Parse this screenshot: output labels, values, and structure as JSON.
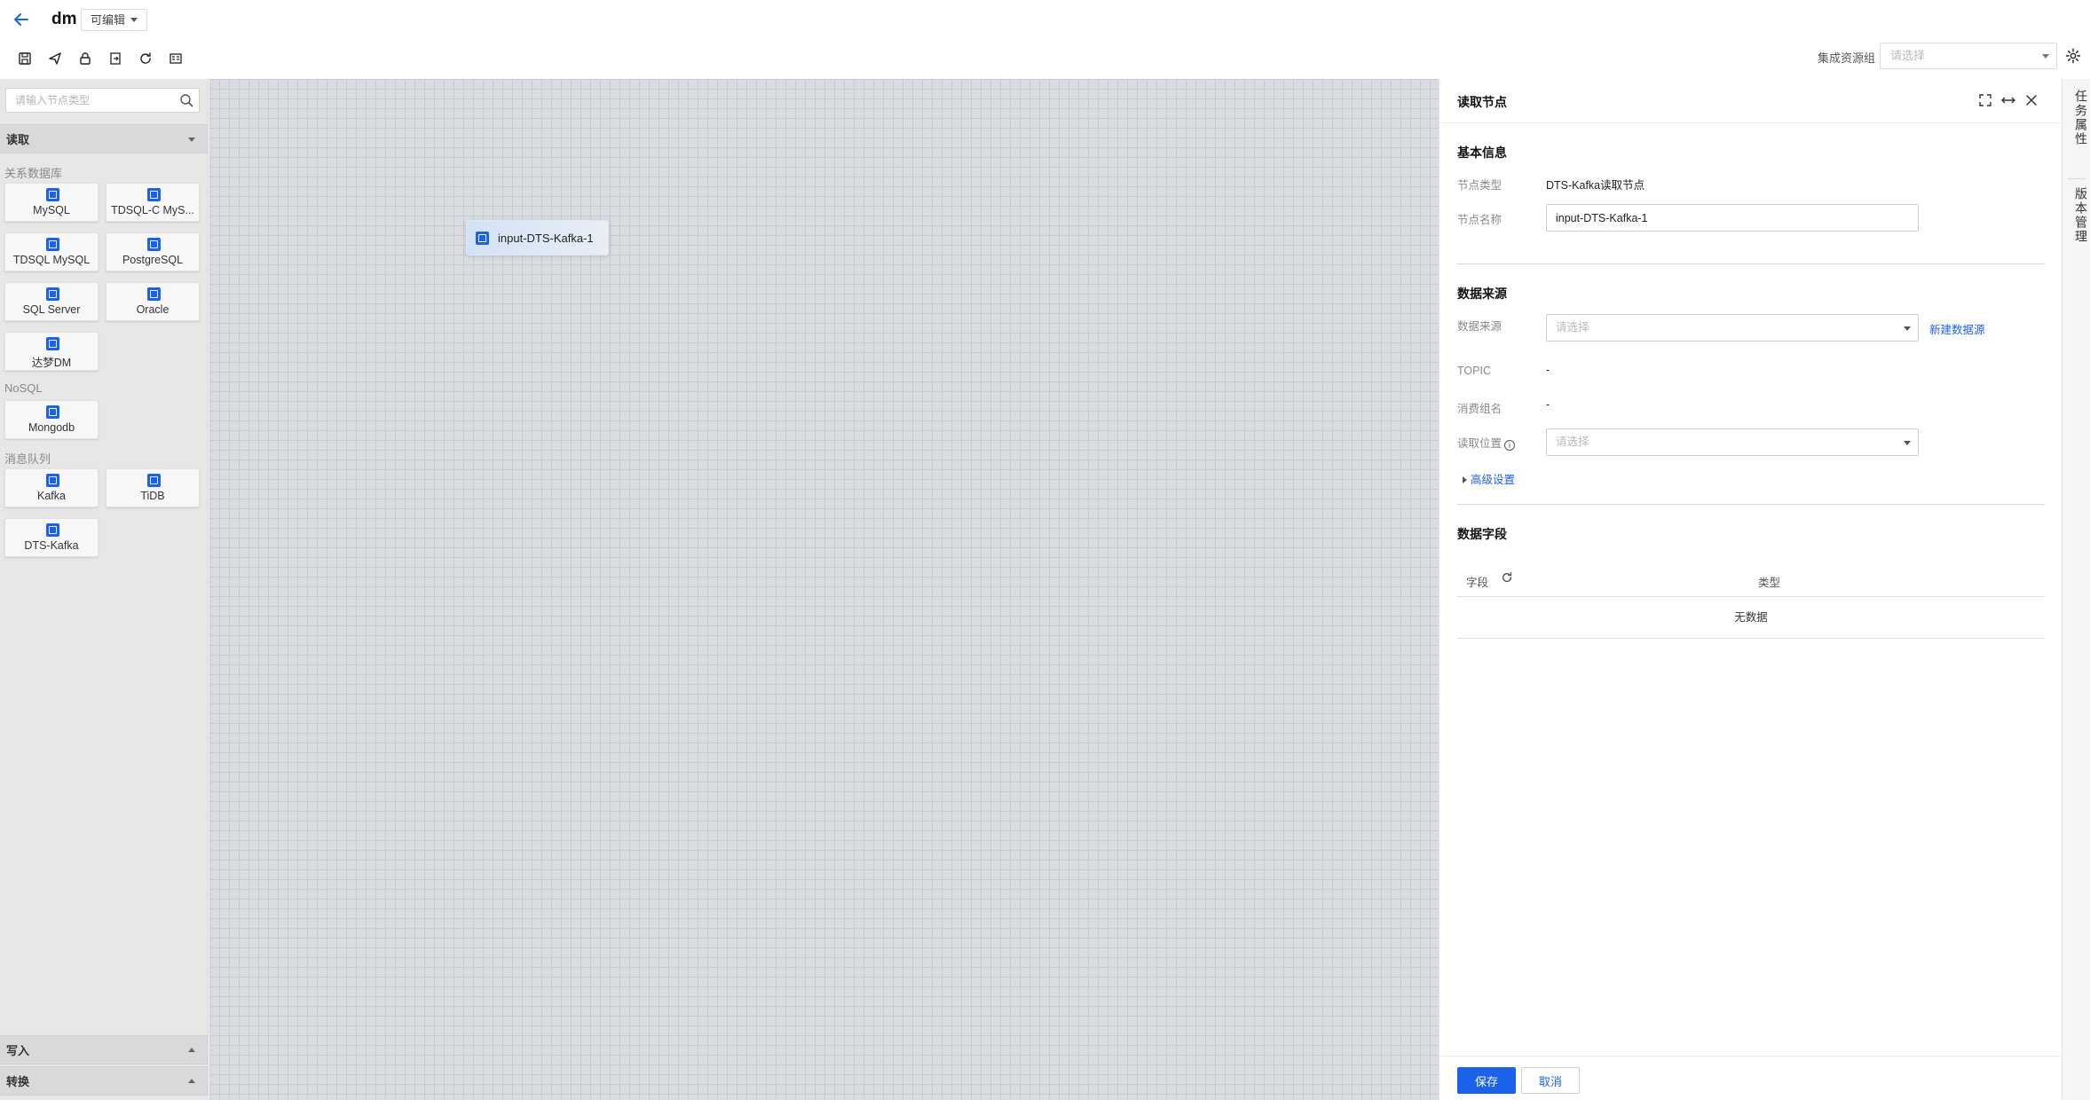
{
  "header": {
    "task_name": "dm",
    "mode_label": "可编辑",
    "resource_group_label": "集成资源组",
    "resource_group_placeholder": "请选择"
  },
  "toolbar": {
    "icons": [
      "save-icon",
      "publish-icon",
      "lock-icon",
      "import-icon",
      "refresh-icon",
      "config-icon"
    ]
  },
  "sidebar": {
    "search_placeholder": "请输入节点类型",
    "read_section": "读取",
    "groups": [
      {
        "label": "关系数据库",
        "items": [
          "MySQL",
          "TDSQL-C MyS...",
          "TDSQL MySQL",
          "PostgreSQL",
          "SQL Server",
          "Oracle",
          "达梦DM"
        ]
      },
      {
        "label": "NoSQL",
        "items": [
          "Mongodb"
        ]
      },
      {
        "label": "消息队列",
        "items": [
          "Kafka",
          "TiDB",
          "DTS-Kafka"
        ]
      }
    ],
    "write_section": "写入",
    "transform_section": "转换"
  },
  "canvas": {
    "node_label": "input-DTS-Kafka-1"
  },
  "panel": {
    "title": "读取节点",
    "basic_info": {
      "title": "基本信息",
      "node_type_label": "节点类型",
      "node_type_value": "DTS-Kafka读取节点",
      "node_name_label": "节点名称",
      "node_name_value": "input-DTS-Kafka-1"
    },
    "data_source": {
      "title": "数据来源",
      "source_label": "数据来源",
      "source_placeholder": "请选择",
      "new_source_link": "新建数据源",
      "topic_label": "TOPIC",
      "topic_value": "-",
      "consumer_group_label": "消费组名",
      "consumer_group_value": "-",
      "read_position_label": "读取位置",
      "read_position_placeholder": "请选择",
      "advanced_link": "高级设置"
    },
    "data_fields": {
      "title": "数据字段",
      "col_field": "字段",
      "col_type": "类型",
      "empty_text": "无数据"
    },
    "save_button": "保存",
    "cancel_button": "取消"
  },
  "vtabs": {
    "task_props": "任务属性",
    "version_mgmt": "版本管理"
  },
  "colors": {
    "primary": "#1c62e8",
    "canvas_bg": "#d9dce1",
    "sidebar_bg": "#e7e7e8"
  }
}
